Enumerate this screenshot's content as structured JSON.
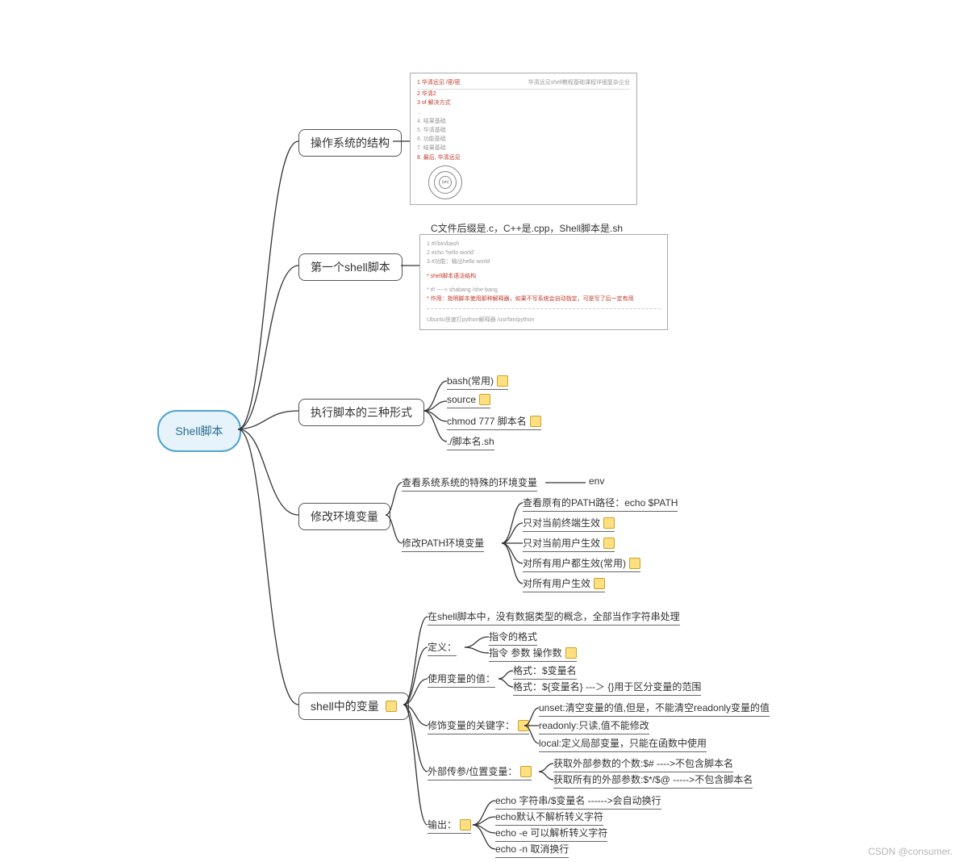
{
  "root": {
    "label": "Shell脚本"
  },
  "branches": [
    {
      "id": "b1",
      "label": "操作系统的结构"
    },
    {
      "id": "b2",
      "label": "第一个shell脚本"
    },
    {
      "id": "b3",
      "label": "执行脚本的三种形式"
    },
    {
      "id": "b4",
      "label": "修改环境变量"
    },
    {
      "id": "b5",
      "label": "shell中的变量"
    }
  ],
  "b2": {
    "caption": "C文件后缀是.c，C++是.cpp，Shell脚本是.sh",
    "code": [
      "1  #!/bin/bash",
      "2  echo 'hello world'",
      "3  #功能：输出hello world",
      "",
      "*  shell脚本语法结构",
      "",
      "*  #! ----> shabang /she-bang",
      "*  作用：指明脚本使用那种解释器，如果不写系统会自动指定，可是写了后一定有用"
    ],
    "footer": "Ubuntu快速打python解释器  /usr/bin/python"
  },
  "b3": {
    "items": [
      {
        "text": "bash(常用)",
        "note": true
      },
      {
        "text": "source",
        "note": true
      },
      {
        "text": "chmod 777 脚本名",
        "note": true
      },
      {
        "text": "./脚本名.sh"
      }
    ]
  },
  "b4": {
    "item1": {
      "text": "查看系统系统的特殊的环境变量",
      "detail": "env"
    },
    "item2": {
      "text": "修改PATH环境变量"
    },
    "sub": [
      {
        "text": "查看原有的PATH路径：echo $PATH"
      },
      {
        "text": "只对当前终端生效",
        "note": true
      },
      {
        "text": "只对当前用户生效",
        "note": true
      },
      {
        "text": "对所有用户都生效(常用)",
        "note": true
      },
      {
        "text": "对所有用户生效",
        "note": true
      }
    ]
  },
  "b5": {
    "note1": "在shell脚本中，没有数据类型的概念，全部当作字符串处理",
    "def_label": "定义：",
    "def_items": [
      "指令的格式",
      "指令  参数  操作数",
      ""
    ],
    "use_label": "使用变量的值：",
    "use_items": [
      "格式：$变量名",
      "格式：${变量名} ---＞ {}用于区分变量的范围"
    ],
    "mod_label": "修饰变量的关键字：",
    "mod_items": [
      "unset:清空变量的值,但是，不能清空readonly变量的值",
      "readonly:只读,值不能修改",
      "local:定义局部变量，只能在函数中使用"
    ],
    "pos_label": "外部传参/位置变量：",
    "pos_items": [
      "获取外部参数的个数:$#   ---->不包含脚本名",
      "获取所有的外部参数:$*/$@   ----->不包含脚本名"
    ],
    "out_label": "输出：",
    "out_items": [
      "echo 字符串/$变量名    ------>会自动换行",
      "echo默认不解析转义字符",
      "echo -e 可以解析转义字符",
      "echo -n 取消换行"
    ]
  },
  "os_card": {
    "header_left": "1  华清远见 /密/密",
    "header_right": "华清远见shell教程基础课程详细复杂企业",
    "lines": [
      "2  华清2",
      "3     of 解决方式",
      "...",
      "4.     结果基础",
      "5.   华清基础",
      "...",
      "6.   功能基础",
      "...",
      "7.   结果基础",
      "...",
      "8.   最后, 华清远见"
    ],
    "center": "(sn)"
  },
  "watermark": "CSDN @consumer."
}
